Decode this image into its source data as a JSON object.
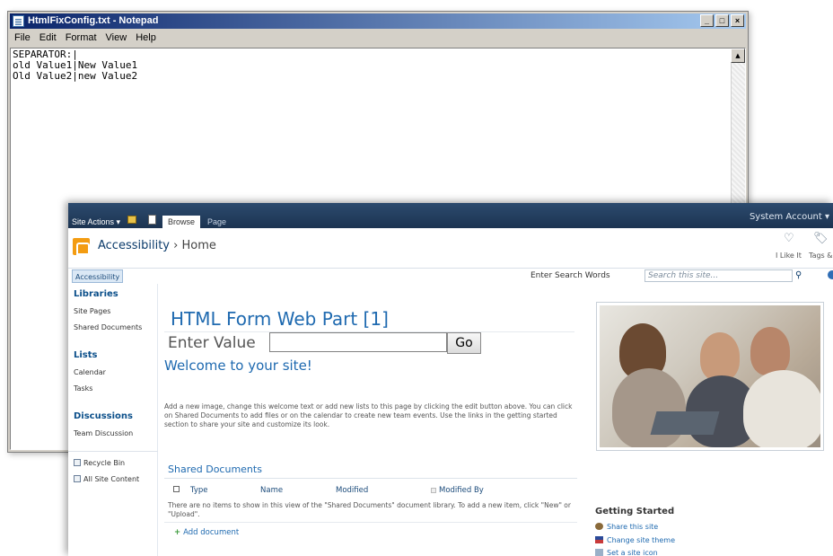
{
  "notepad": {
    "title": "HtmlFixConfig.txt - Notepad",
    "menu": [
      "File",
      "Edit",
      "Format",
      "View",
      "Help"
    ],
    "content": "SEPARATOR:|\nold Value1|New Value1\nOld Value2|new Value2",
    "controls": [
      "minimize-icon",
      "maximize-icon",
      "close-icon"
    ]
  },
  "sharepoint": {
    "ribbon": {
      "site_actions": "Site Actions ▾",
      "tabs": [
        "Browse",
        "Page"
      ],
      "account": "System Account ▾"
    },
    "header": {
      "site_name": "Accessibility",
      "breadcrumb": "Home",
      "like_label": "I Like It",
      "tags_label": "Tags &"
    },
    "nav": {
      "tab": "Accessibility",
      "search_label": "Enter Search Words",
      "search_placeholder": "Search this site..."
    },
    "left_nav": {
      "libraries": "Libraries",
      "site_pages": "Site Pages",
      "shared_documents": "Shared Documents",
      "lists": "Lists",
      "calendar": "Calendar",
      "tasks": "Tasks",
      "discussions": "Discussions",
      "team_discussion": "Team Discussion",
      "recycle_bin": "Recycle Bin",
      "all_site_content": "All Site Content"
    },
    "main": {
      "webpart_title": "HTML Form Web Part [1]",
      "enter_value_label": "Enter Value",
      "enter_value_input": "",
      "go_button": "Go",
      "welcome": "Welcome to your site!",
      "body_text": "Add a new image, change this welcome text or add new lists to this page by clicking the edit button above. You can click on Shared Documents to add files or on the calendar to create new team events. Use the links in the getting started section to share your site and customize its look."
    },
    "shared_docs": {
      "title": "Shared Documents",
      "columns": [
        "Type",
        "Name",
        "Modified",
        "Modified By"
      ],
      "empty_text": "There are no items to show in this view of the \"Shared Documents\" document library. To add a new item, click \"New\" or \"Upload\".",
      "add_document": "Add document"
    },
    "getting_started": {
      "title": "Getting Started",
      "items": [
        "Share this site",
        "Change site theme",
        "Set a site icon"
      ]
    },
    "colors": {
      "ribbon": "#1c3452",
      "accent": "#1f6ab0",
      "title_bar": "#0a246a"
    }
  }
}
